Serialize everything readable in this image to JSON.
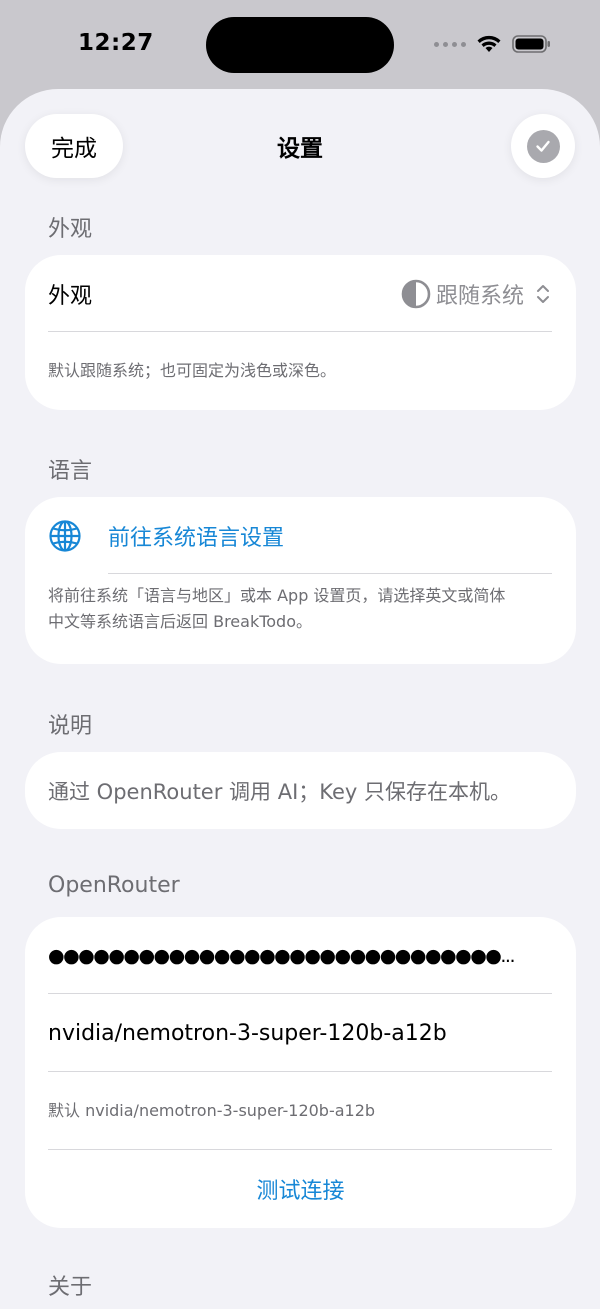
{
  "status_bar": {
    "time": "12:27"
  },
  "nav": {
    "done_label": "完成",
    "title": "设置"
  },
  "appearance": {
    "header": "外观",
    "row_label": "外观",
    "value": "跟随系统",
    "footnote": "默认跟随系统；也可固定为浅色或深色。"
  },
  "language": {
    "header": "语言",
    "link_label": "前往系统语言设置",
    "footnote_line1": "将前往系统「语言与地区」或本 App 设置页，请选择英文或简体",
    "footnote_line2": "中文等系统语言后返回 BreakTodo。"
  },
  "info": {
    "header": "说明",
    "text": "通过 OpenRouter 调用 AI；Key 只保存在本机。"
  },
  "openrouter": {
    "header": "OpenRouter",
    "api_key_masked": "●●●●●●●●●●●●●●●●●●●●●●●●●●●●●●...",
    "model_value": "nvidia/nemotron-3-super-120b-a12b",
    "default_note": "默认 nvidia/nemotron-3-super-120b-a12b",
    "test_button_label": "测试连接"
  },
  "about": {
    "header": "关于"
  },
  "colors": {
    "accent": "#1787d6",
    "background": "#f2f2f7",
    "card": "#ffffff",
    "secondary_text": "#6d6d72"
  }
}
